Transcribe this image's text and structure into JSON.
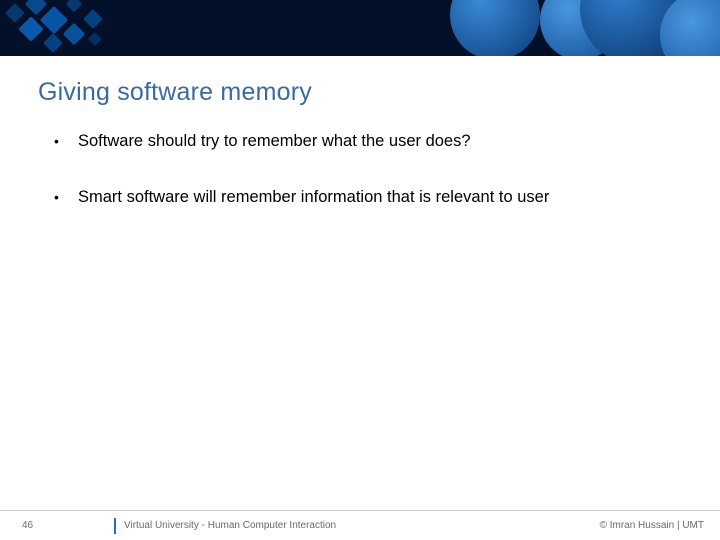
{
  "title": "Giving software memory",
  "bullets": [
    "Software should try to remember what the user does?",
    "Smart software will remember information that is relevant to user"
  ],
  "footer": {
    "page": "46",
    "center": "Virtual University - Human Computer Interaction",
    "right": "© Imran Hussain | UMT"
  }
}
